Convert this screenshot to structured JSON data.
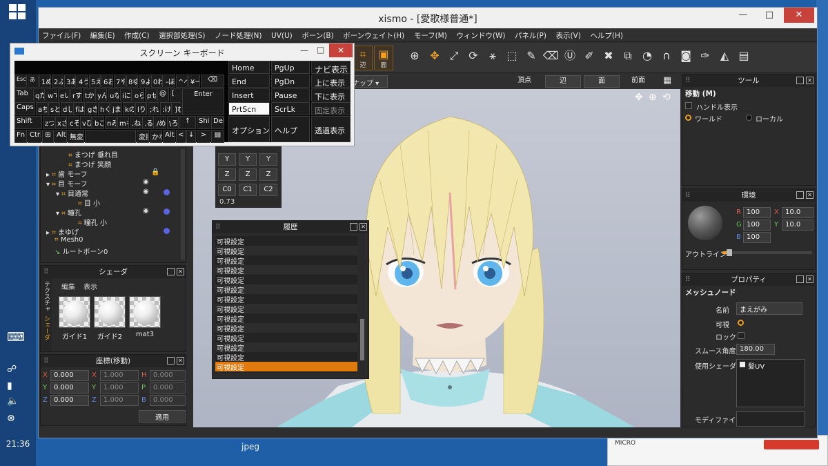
{
  "desktop": {
    "clock": "21:36",
    "desktop_label": "jpeg",
    "bg_window_logo": "MICRO"
  },
  "app": {
    "title": "xismo - [愛歌様普通*]",
    "window_controls": {
      "minimize": "—",
      "maximize": "□",
      "close": "✕"
    },
    "menu": [
      "ファイル(F)",
      "編集(E)",
      "作成(C)",
      "選択部処理(S)",
      "ノード処理(N)",
      "UV(U)",
      "ボーン(B)",
      "ボーンウェイト(H)",
      "モーフ(M)",
      "ウィンドウ(W)",
      "パネル(P)",
      "表示(V)",
      "ヘルプ(H)"
    ],
    "toolbar": {
      "edge_label": "辺",
      "face_label": "面"
    },
    "viewport": {
      "snap": "スナップ",
      "modes": [
        "頂点",
        "辺",
        "面",
        "前面"
      ]
    },
    "tree": {
      "rows": [
        {
          "label": "まつげ 垂れ目",
          "indent": 1
        },
        {
          "label": "まつげ 笑顔",
          "indent": 1
        },
        {
          "label": "歯 モーフ",
          "indent": 0
        },
        {
          "label": "目 モーフ",
          "indent": 0
        },
        {
          "label": "目通常",
          "indent": 1
        },
        {
          "label": "目 小",
          "indent": 2
        },
        {
          "label": "瞳孔",
          "indent": 1
        },
        {
          "label": "瞳孔 小",
          "indent": 2
        },
        {
          "label": "まゆげ",
          "indent": 0
        },
        {
          "label": "Mesh0",
          "indent": 0
        },
        {
          "label": "ルートボーン0",
          "indent": 0
        }
      ]
    },
    "shader_panel": {
      "title": "シェーダ",
      "menu": [
        "編集",
        "表示"
      ],
      "side_tabs": [
        "テクスチャ",
        "シェーダ"
      ],
      "thumbnails": [
        "ガイド1",
        "ガイド2",
        "mat3"
      ]
    },
    "coord_panel": {
      "title": "座標(移動)",
      "rows": [
        {
          "a": "X",
          "av": "0.000",
          "b": "X",
          "bv": "1.000",
          "c": "H",
          "cv": "0.000"
        },
        {
          "a": "Y",
          "av": "0.000",
          "b": "Y",
          "bv": "1.000",
          "c": "P",
          "cv": "0.000"
        },
        {
          "a": "Z",
          "av": "0.000",
          "b": "Z",
          "bv": "1.000",
          "c": "B",
          "cv": "0.000"
        }
      ],
      "apply": "適用"
    },
    "numpad": {
      "rows": [
        [
          "Y",
          "Y",
          "Y"
        ],
        [
          "Z",
          "Z",
          "Z"
        ],
        [
          "C0",
          "C1",
          "C2"
        ]
      ],
      "value": "0.73"
    },
    "history": {
      "title": "履歴",
      "items": [
        "可視設定",
        "可視設定",
        "可視設定",
        "可視設定",
        "可視設定",
        "可視設定",
        "可視設定",
        "可視設定",
        "可視設定",
        "可視設定",
        "可視設定",
        "可視設定",
        "可視設定",
        "可視設定"
      ],
      "selected_index": 13
    },
    "tool_panel": {
      "title": "ツール",
      "heading": "移動 (M)",
      "handle_label": "ハンドル表示",
      "world": "ワールド",
      "local": "ローカル"
    },
    "env_panel": {
      "title": "環境",
      "r_label": "R",
      "r": "100",
      "g_label": "G",
      "g": "100",
      "b_label": "B",
      "b": "100",
      "x_label": "X",
      "x": "10.0",
      "y_label": "Y",
      "y": "10.0",
      "outline": "アウトライン"
    },
    "property_panel": {
      "title": "プロパティ",
      "heading": "メッシュノード",
      "name_label": "名前",
      "name": "まえがみ",
      "visible_label": "可視",
      "lock_label": "ロック",
      "smooth_label": "スムース角度",
      "smooth": "180.00",
      "shader_label": "使用シェーダ",
      "shader": "髪UV",
      "modifier_label": "モディファイア"
    },
    "colors": {
      "accent": "#e07a0e",
      "panel": "#2b2b2b",
      "viewport_top": "#c7cbd6"
    }
  },
  "osk": {
    "title": "スクリーン キーボード",
    "row1": [
      "Esc",
      "あ",
      "1ぬ",
      "2ふ",
      "3あ",
      "4う",
      "5え",
      "6お",
      "7や",
      "8ゆ",
      "9よ",
      "0わ",
      "-ほ",
      "^へ",
      "¥ー",
      "⌫"
    ],
    "row2": [
      "Tab",
      "qた",
      "wて",
      "eい",
      "rす",
      "tか",
      "yん",
      "uな",
      "iに",
      "oら",
      "pせ",
      "@",
      "[",
      "Enter"
    ],
    "row3": [
      "Caps",
      "aち",
      "sと",
      "dし",
      "fは",
      "gき",
      "hく",
      "jま",
      "kの",
      "lり",
      ";れ",
      ":け",
      "]む"
    ],
    "row4": [
      "Shift",
      "zつ",
      "xさ",
      "cそ",
      "vひ",
      "bこ",
      "nみ",
      "mも",
      ",ね",
      ".る",
      "/め",
      "\\ろ",
      "↑",
      "Shi",
      "Del"
    ],
    "row5": [
      "Fn",
      "Ctrl",
      "⊞",
      "Alt",
      "無変",
      " ",
      "変換",
      "かな",
      "Alt",
      "<",
      "↓",
      ">",
      "▤"
    ],
    "right": [
      [
        "Home",
        "PgUp",
        "ナビ表示"
      ],
      [
        "End",
        "PgDn",
        "上に表示"
      ],
      [
        "Insert",
        "Pause",
        "下に表示"
      ],
      [
        "PrtScn",
        "ScrLk",
        "固定表示"
      ],
      [
        "オプション",
        "ヘルプ",
        "透過表示"
      ]
    ]
  }
}
